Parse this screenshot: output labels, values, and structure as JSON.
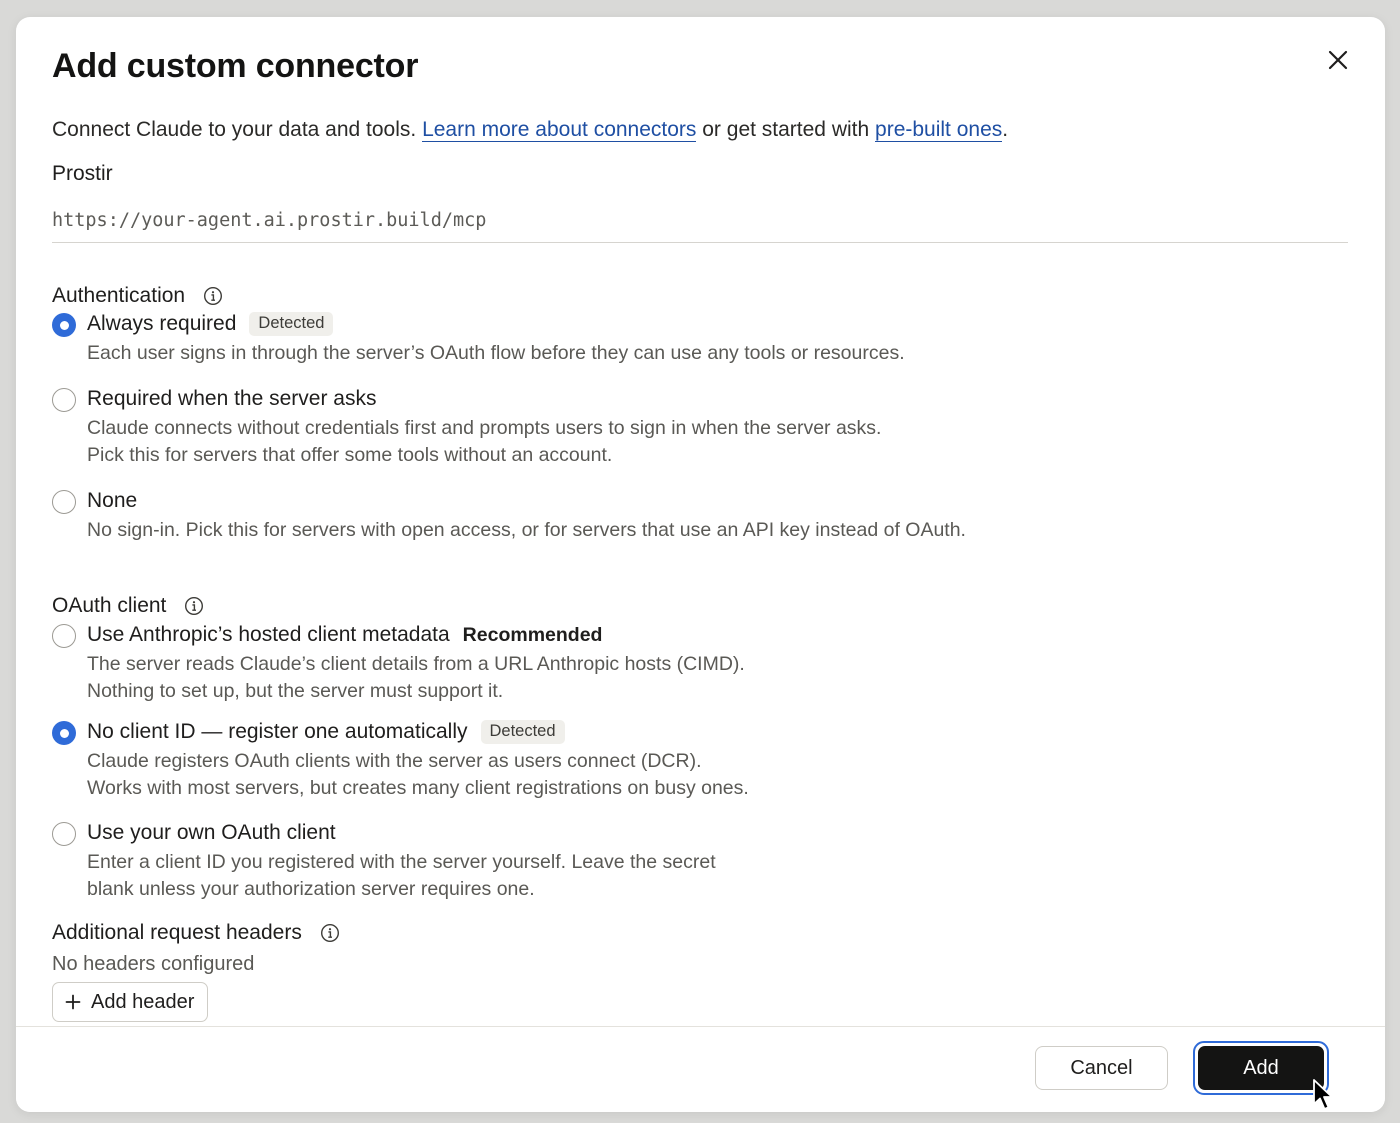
{
  "dialog": {
    "title": "Add custom connector",
    "subtitle_prefix": "Connect Claude to your data and tools. ",
    "learn_more_link": "Learn more about connectors",
    "subtitle_middle": " or get started with ",
    "prebuilt_link": "pre-built ones",
    "subtitle_suffix": "."
  },
  "server": {
    "name": "Prostir",
    "url": "https://your-agent.ai.prostir.build/mcp"
  },
  "authentication": {
    "heading": "Authentication",
    "options": [
      {
        "label": "Always required",
        "badge": "Detected",
        "description": [
          "Each user signs in through the server’s OAuth flow before they can use any tools or resources."
        ],
        "selected": true
      },
      {
        "label": "Required when the server asks",
        "description": [
          "Claude connects without credentials first and prompts users to sign in when the server asks.",
          "Pick this for servers that offer some tools without an account."
        ],
        "selected": false
      },
      {
        "label": "None",
        "description": [
          "No sign-in. Pick this for servers with open access, or for servers that use an API key instead of OAuth."
        ],
        "selected": false
      }
    ]
  },
  "oauth_client": {
    "heading": "OAuth client",
    "options": [
      {
        "label": "Use Anthropic’s hosted client metadata",
        "tag": "Recommended",
        "description": [
          "The server reads Claude’s client details from a URL Anthropic hosts (CIMD).",
          "Nothing to set up, but the server must support it."
        ],
        "selected": false
      },
      {
        "label": "No client ID — register one automatically",
        "badge": "Detected",
        "description": [
          "Claude registers OAuth clients with the server as users connect (DCR).",
          "Works with most servers, but creates many client registrations on busy ones."
        ],
        "selected": true
      },
      {
        "label": "Use your own OAuth client",
        "description": [
          "Enter a client ID you registered with the server yourself. Leave the secret",
          "blank unless your authorization server requires one."
        ],
        "selected": false
      }
    ]
  },
  "headers": {
    "heading": "Additional request headers",
    "empty_text": "No headers configured",
    "add_label": "Add header"
  },
  "footer": {
    "cancel_label": "Cancel",
    "add_label": "Add"
  },
  "colors": {
    "accent": "#2f6bd8",
    "link": "#1f4fa3",
    "primary_button": "#141413"
  },
  "icons": {
    "close": "close-icon",
    "info": "info-icon",
    "plus": "plus-icon",
    "cursor": "mouse-cursor-icon"
  }
}
